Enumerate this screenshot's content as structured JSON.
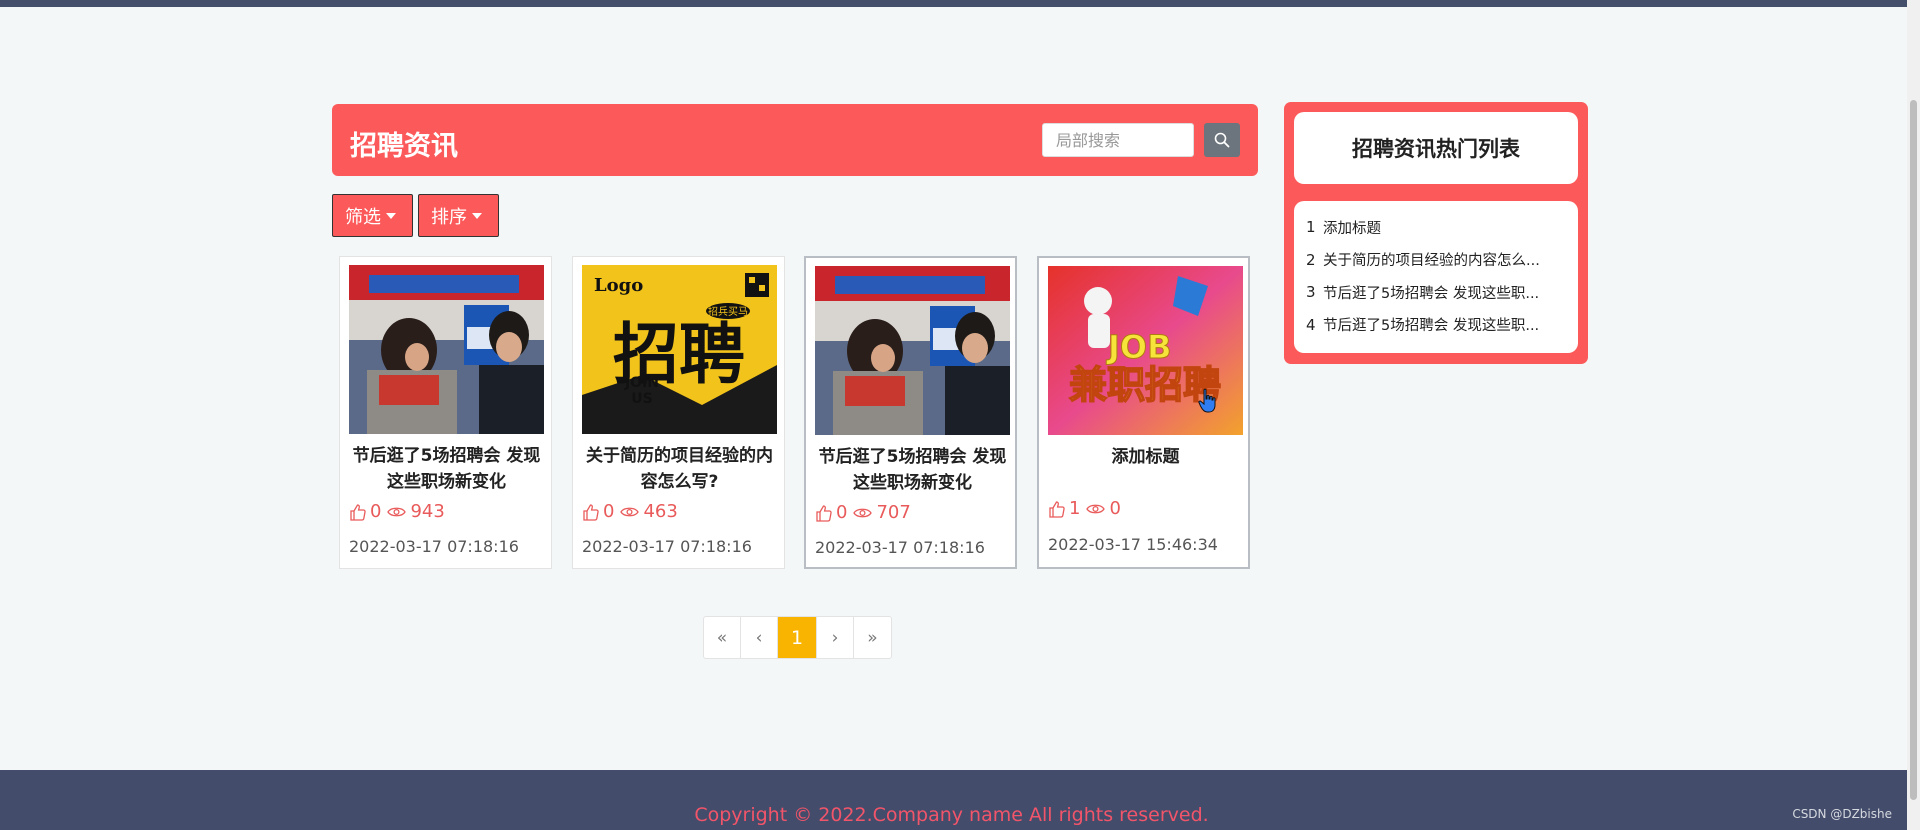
{
  "header": {
    "title": "招聘资讯"
  },
  "search": {
    "placeholder": "局部搜索",
    "button_icon": "search-icon"
  },
  "filters": {
    "filter_label": "筛选",
    "sort_label": "排序"
  },
  "cards": [
    {
      "title": "节后逛了5场招聘会 发现这些职场新变化",
      "likes": "0",
      "views": "943",
      "date": "2022-03-17 07:18:16",
      "image": "job-fair-photo"
    },
    {
      "title": "关于简历的项目经验的内容怎么写?",
      "likes": "0",
      "views": "463",
      "date": "2022-03-17 07:18:16",
      "image": "join-us-poster",
      "image_text": {
        "logo": "Logo",
        "big": "招聘",
        "join": "JOIN",
        "us": "US",
        "badge": "招兵买马"
      }
    },
    {
      "title": "节后逛了5场招聘会 发现这些职场新变化",
      "likes": "0",
      "views": "707",
      "date": "2022-03-17 07:18:16",
      "image": "job-fair-photo"
    },
    {
      "title": "添加标题",
      "likes": "1",
      "views": "0",
      "date": "2022-03-17 15:46:34",
      "image": "part-time-job-poster",
      "image_text": {
        "job": "JOB",
        "big": "兼职招聘"
      }
    }
  ],
  "pagination": {
    "first": "«",
    "prev": "‹",
    "current": "1",
    "next": "›",
    "last": "»"
  },
  "sidebar": {
    "title": "招聘资讯热门列表",
    "items": [
      {
        "index": "1",
        "label": "添加标题"
      },
      {
        "index": "2",
        "label": "关于简历的项目经验的内容怎么..."
      },
      {
        "index": "3",
        "label": "节后逛了5场招聘会 发现这些职..."
      },
      {
        "index": "4",
        "label": "节后逛了5场招聘会 发现这些职..."
      }
    ]
  },
  "footer": {
    "copyright": "Copyright © 2022.Company name All rights reserved.",
    "watermark": "CSDN @DZbishe"
  },
  "colors": {
    "accent": "#fc5a5a",
    "footer_bg": "#434d6b",
    "page_current": "#f8b400",
    "copyright": "#f2546a"
  }
}
